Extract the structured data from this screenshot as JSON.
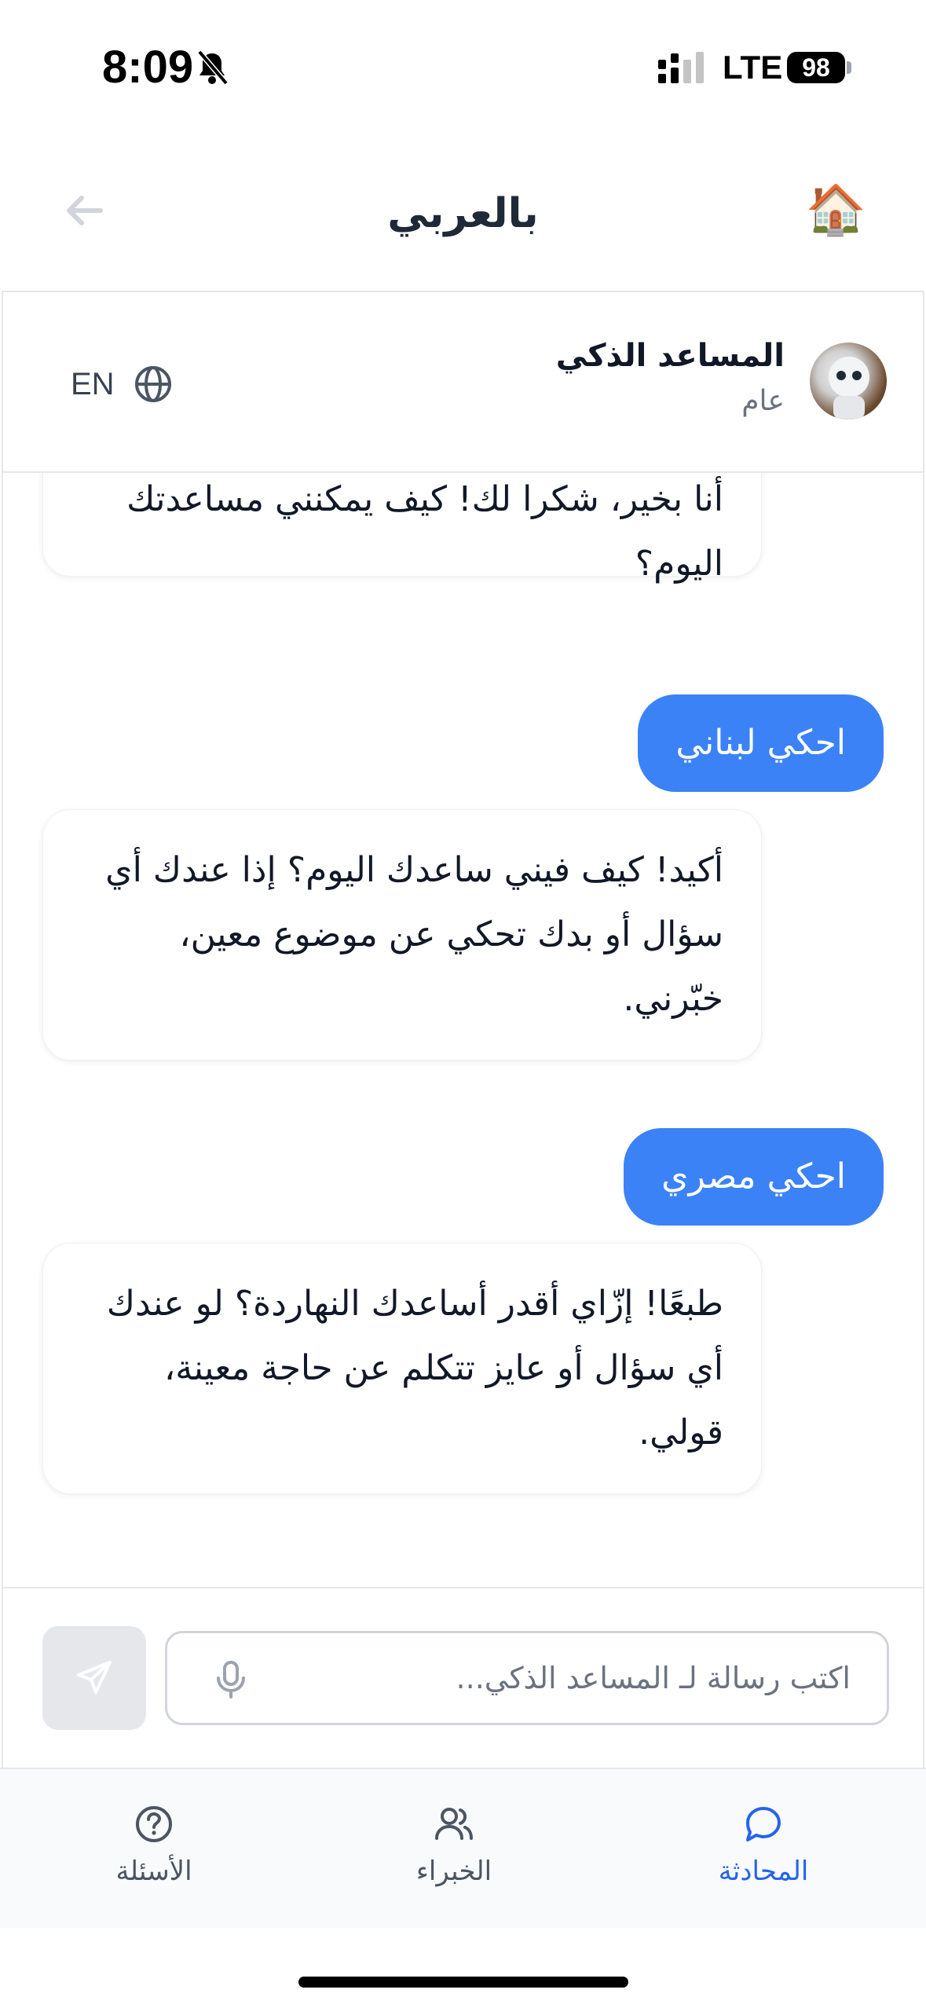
{
  "status_bar": {
    "time": "8:09",
    "network": "LTE",
    "battery": "98"
  },
  "nav": {
    "title": "بالعربي",
    "back_icon": "arrow-left-icon",
    "home_icon": "house-emoji",
    "home_glyph": "🏠"
  },
  "chat_header": {
    "assistant_name": "المساعد الذكي",
    "category": "عام",
    "language_label": "EN",
    "language_icon": "globe-icon"
  },
  "messages": [
    {
      "role": "assistant",
      "text": "أنا بخير، شكرا لك! كيف يمكنني مساعدتك اليوم؟"
    },
    {
      "role": "user",
      "text": "احكي لبناني"
    },
    {
      "role": "assistant",
      "text": "أكيد! كيف فيني ساعدك اليوم؟ إذا عندك أي سؤال أو بدك تحكي عن موضوع معين، خبّرني."
    },
    {
      "role": "user",
      "text": "احكي مصري"
    },
    {
      "role": "assistant",
      "text": "طبعًا! إزّاي أقدر أساعدك النهاردة؟ لو عندك أي سؤال أو عايز تتكلم عن حاجة معينة، قولي."
    }
  ],
  "composer": {
    "placeholder": "اكتب رسالة لـ المساعد الذكي...",
    "value": "",
    "send_icon": "send-icon",
    "mic_icon": "microphone-icon"
  },
  "tabs": [
    {
      "label": "المحادثة",
      "icon": "chat-bubble-icon",
      "active": true
    },
    {
      "label": "الخبراء",
      "icon": "users-icon",
      "active": false
    },
    {
      "label": "الأسئلة",
      "icon": "help-circle-icon",
      "active": false
    }
  ],
  "colors": {
    "accent": "#3b82f6",
    "active_tab": "#2563eb",
    "muted": "#6b7280"
  }
}
